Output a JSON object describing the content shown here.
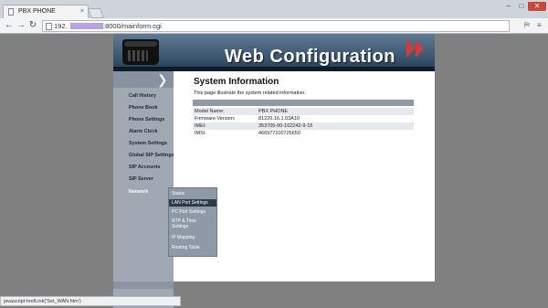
{
  "browser": {
    "tab_title": "PBX PHONE",
    "tab_close": "×",
    "url_host": "192.",
    "url_rest": ":8000/mainform.cgi",
    "controls": {
      "minimize": "–",
      "maximize": "□",
      "close": "✕"
    },
    "icons": [
      "back-icon",
      "forward-icon",
      "reload-icon",
      "translate-icon",
      "menu-icon"
    ],
    "status_text": "javascript:hrefLink('Set_WAN.htm')"
  },
  "header": {
    "title": "Web Configuration"
  },
  "sidebar": {
    "items": [
      {
        "label": "Call History"
      },
      {
        "label": "Phone Book"
      },
      {
        "label": "Phone Settings"
      },
      {
        "label": "Alarm Clock"
      },
      {
        "label": "System Settings"
      },
      {
        "label": "Global SIP Settings"
      },
      {
        "label": "SIP Accounts"
      },
      {
        "label": "SIP Server"
      },
      {
        "label": "Network"
      }
    ]
  },
  "flyout": {
    "items": [
      {
        "label": "Status"
      },
      {
        "label": "LAN Port Settings"
      },
      {
        "label": "PC Port Settings"
      },
      {
        "label": "NTP & Time"
      },
      {
        "label": "Settings"
      },
      {
        "label": "IP Mapping"
      },
      {
        "label": "Routing Table"
      }
    ]
  },
  "main": {
    "title": "System Information",
    "description": "This page illustrate the system related information.",
    "rows": [
      {
        "label": "Model Name:",
        "value": "PBX PHONE"
      },
      {
        "label": "Firmware Version:",
        "value": "81220.16.1.03A10"
      },
      {
        "label": "IMEI:",
        "value": "353705-00-162242-9-15"
      },
      {
        "label": "IMSI:",
        "value": "466977100725650"
      }
    ]
  },
  "colors": {
    "accent_red": "#d63b3b",
    "row_even": "#e6e9ee",
    "row_odd": "#ffffff",
    "menu_highlight": "#2d3a4b"
  }
}
